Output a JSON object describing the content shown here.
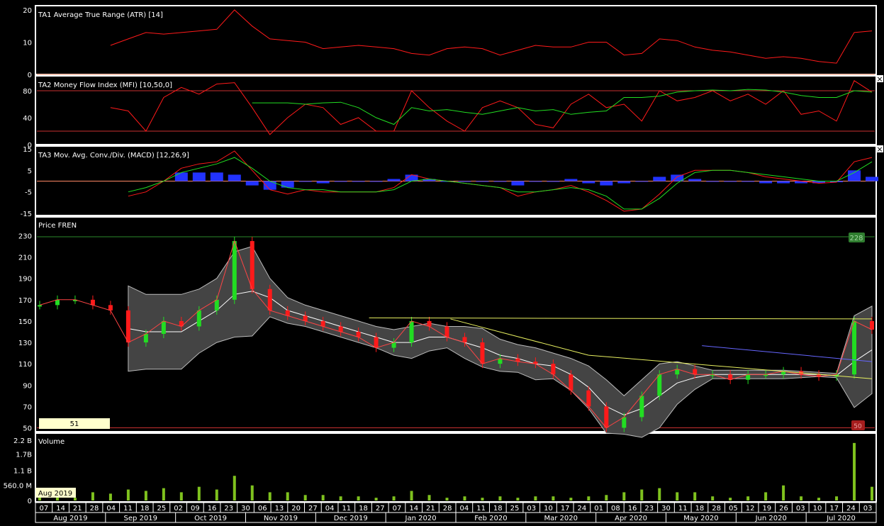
{
  "colors": {
    "background": "#000000",
    "border": "#ffffff",
    "red": "#ff1a1a",
    "green": "#22dd22",
    "blue": "#2233ff",
    "volume": "#7fc21e",
    "band": "#444444",
    "mid": "#ffffff",
    "trend_blue": "#6666ff",
    "trend_yellow": "#e8f060",
    "badge_green": "#2f7d2f",
    "badge_red": "#a51d1d",
    "cursor_label_bg": "#ffffcc"
  },
  "panels": {
    "atr": {
      "title": "TA1 Average True Range (ATR) [14]",
      "ticks": [
        "20",
        "10",
        "0"
      ]
    },
    "mfi": {
      "title": "TA2 Money Flow Index (MFI) [10,50,0]",
      "ticks": [
        "80",
        "40",
        "0"
      ]
    },
    "macd": {
      "title": "TA3 Mov. Avg. Conv./Div. (MACD) [12,26,9]",
      "ticks": [
        "15",
        "5",
        "-5",
        "-15"
      ]
    },
    "price": {
      "title": "Price FREN",
      "ticks": [
        "230",
        "210",
        "190",
        "170",
        "150",
        "130",
        "110",
        "90",
        "70",
        "50"
      ],
      "high_badge": "228",
      "low_badge": "50",
      "cursor_value": "51"
    },
    "volume": {
      "title": "Volume",
      "ticks": [
        "2.2 B",
        "1.7B",
        "1.1 B",
        "560.0 M",
        "0"
      ],
      "cursor_date": "Aug 2019"
    }
  },
  "close_icon": "×",
  "chart_data": [
    {
      "type": "line",
      "title": "TA1 Average True Range (ATR) [14]",
      "ylim": [
        0,
        20
      ],
      "x_index": [
        0,
        5,
        10,
        15,
        20,
        25,
        30,
        35,
        40,
        45,
        50,
        55,
        60,
        65,
        70,
        75,
        80,
        85,
        90,
        95,
        100,
        105,
        110,
        115,
        120,
        125,
        130,
        135,
        140,
        145,
        150,
        155,
        160,
        165,
        170,
        175,
        180,
        185,
        190,
        195,
        200,
        205,
        210,
        215,
        220,
        225,
        230,
        235
      ],
      "series": [
        {
          "values": [
            null,
            null,
            null,
            null,
            9,
            11,
            13,
            12.5,
            13,
            13.5,
            14,
            20,
            15,
            11,
            10.5,
            10,
            8,
            8.5,
            9,
            8.5,
            8,
            6.5,
            6,
            8,
            8.5,
            8,
            6,
            7.5,
            9,
            8.5,
            8.5,
            10,
            10,
            6,
            6.5,
            11,
            10.5,
            8.5,
            7.5,
            7,
            6,
            5,
            5.5,
            5,
            4,
            3.5,
            13,
            13.5
          ]
        }
      ]
    },
    {
      "type": "line",
      "title": "TA2 Money Flow Index (MFI) [10,50,0]",
      "ylim": [
        0,
        100
      ],
      "reference_lines": [
        80,
        20
      ],
      "x_index": [
        0,
        5,
        10,
        15,
        20,
        25,
        30,
        35,
        40,
        45,
        50,
        55,
        60,
        65,
        70,
        75,
        80,
        85,
        90,
        95,
        100,
        105,
        110,
        115,
        120,
        125,
        130,
        135,
        140,
        145,
        150,
        155,
        160,
        165,
        170,
        175,
        180,
        185,
        190,
        195,
        200,
        205,
        210,
        215,
        220,
        225,
        230,
        235
      ],
      "series": [
        {
          "values": [
            null,
            null,
            null,
            null,
            55,
            50,
            20,
            70,
            85,
            75,
            90,
            92,
            55,
            15,
            40,
            60,
            55,
            30,
            40,
            20,
            20,
            80,
            55,
            35,
            20,
            55,
            65,
            55,
            30,
            25,
            60,
            75,
            55,
            60,
            35,
            80,
            65,
            70,
            80,
            65,
            75,
            60,
            80,
            45,
            50,
            35,
            95,
            78
          ]
        },
        {
          "values": [
            null,
            null,
            null,
            null,
            null,
            null,
            null,
            null,
            null,
            null,
            null,
            null,
            62,
            62,
            62,
            60,
            62,
            63,
            55,
            40,
            30,
            55,
            50,
            52,
            48,
            45,
            50,
            55,
            50,
            52,
            45,
            48,
            50,
            70,
            70,
            72,
            78,
            80,
            81,
            80,
            82,
            81,
            78,
            73,
            70,
            70,
            80,
            78
          ]
        }
      ]
    },
    {
      "type": "bar",
      "title": "TA3 Mov. Avg. Conv./Div. (MACD) [12,26,9]",
      "ylim": [
        -15,
        15
      ],
      "x_index": [
        0,
        5,
        10,
        15,
        20,
        25,
        30,
        35,
        40,
        45,
        50,
        55,
        60,
        65,
        70,
        75,
        80,
        85,
        90,
        95,
        100,
        105,
        110,
        115,
        120,
        125,
        130,
        135,
        140,
        145,
        150,
        155,
        160,
        165,
        170,
        175,
        180,
        185,
        190,
        195,
        200,
        205,
        210,
        215,
        220,
        225,
        230,
        235
      ],
      "series": [
        {
          "values": [
            null,
            null,
            null,
            null,
            null,
            -7,
            -5,
            0,
            6,
            8,
            9,
            14,
            5,
            -4,
            -6,
            -4,
            -5,
            -5,
            -5,
            -5,
            -3,
            3,
            1,
            0,
            -1,
            -2,
            -3,
            -7,
            -5,
            -4,
            -2,
            -5,
            -9,
            -14,
            -13,
            -6,
            2,
            5,
            5,
            5,
            4,
            2,
            1,
            0,
            -1,
            -0.5,
            9,
            11
          ]
        },
        {
          "values": [
            null,
            null,
            null,
            null,
            null,
            -5,
            -3,
            0,
            4,
            6,
            8,
            11,
            6,
            0,
            -3,
            -4,
            -4,
            -5,
            -5,
            -5,
            -4,
            0,
            1,
            0,
            -1,
            -2,
            -3,
            -5,
            -5,
            -4,
            -3,
            -4,
            -7,
            -13,
            -13,
            -8,
            -1,
            4,
            5,
            5,
            4,
            3,
            2,
            1,
            0,
            0,
            4,
            9
          ]
        },
        {
          "values": [
            null,
            null,
            null,
            null,
            null,
            null,
            null,
            null,
            4,
            4,
            4,
            3,
            -2,
            -4,
            -3,
            0,
            -1,
            0,
            0,
            0,
            1,
            3,
            1,
            0,
            0,
            0,
            0,
            -2,
            0,
            0,
            1,
            -1,
            -2,
            -1,
            0,
            2,
            3,
            1,
            0,
            0,
            0,
            -1,
            -1,
            -1,
            -1,
            -0.5,
            5,
            2
          ]
        }
      ]
    },
    {
      "type": "line",
      "title": "Price FREN",
      "ylim": [
        45,
        235
      ],
      "x_index": [
        0,
        5,
        10,
        15,
        20,
        25,
        30,
        35,
        40,
        45,
        50,
        55,
        60,
        65,
        70,
        75,
        80,
        85,
        90,
        95,
        100,
        105,
        110,
        115,
        120,
        125,
        130,
        135,
        140,
        145,
        150,
        155,
        160,
        165,
        170,
        175,
        180,
        185,
        190,
        195,
        200,
        205,
        210,
        215,
        220,
        225,
        230,
        235
      ],
      "series": [
        {
          "values": [
            165,
            170,
            170,
            165,
            160,
            130,
            138,
            150,
            145,
            160,
            170,
            225,
            180,
            160,
            155,
            150,
            145,
            140,
            135,
            125,
            130,
            150,
            145,
            135,
            130,
            110,
            115,
            112,
            110,
            100,
            85,
            70,
            50,
            60,
            80,
            100,
            105,
            100,
            100,
            95,
            100,
            100,
            103,
            100,
            98,
            100,
            150,
            142
          ]
        },
        {
          "values": [
            null,
            null,
            null,
            null,
            null,
            143,
            140,
            140,
            140,
            150,
            160,
            175,
            178,
            172,
            160,
            155,
            150,
            145,
            140,
            135,
            130,
            130,
            135,
            135,
            130,
            125,
            118,
            115,
            110,
            108,
            100,
            88,
            70,
            62,
            68,
            80,
            92,
            97,
            100,
            100,
            100,
            100,
            100,
            100,
            100,
            99,
            112,
            123
          ]
        },
        {
          "values": [
            null,
            null,
            null,
            null,
            null,
            183,
            175,
            175,
            175,
            180,
            190,
            215,
            220,
            190,
            172,
            165,
            160,
            155,
            150,
            145,
            142,
            145,
            148,
            145,
            145,
            143,
            133,
            128,
            125,
            120,
            115,
            108,
            95,
            80,
            95,
            110,
            112,
            108,
            104,
            104,
            104,
            104,
            104,
            103,
            102,
            101,
            155,
            164
          ]
        },
        {
          "values": [
            null,
            null,
            null,
            null,
            null,
            103,
            105,
            105,
            105,
            120,
            130,
            135,
            136,
            154,
            148,
            145,
            140,
            135,
            130,
            125,
            118,
            115,
            122,
            125,
            115,
            107,
            103,
            102,
            95,
            96,
            85,
            68,
            45,
            44,
            41,
            50,
            72,
            86,
            96,
            96,
            96,
            96,
            96,
            97,
            98,
            97,
            69,
            82
          ]
        }
      ]
    },
    {
      "type": "bar",
      "title": "Volume",
      "ylim": [
        0,
        2.2
      ],
      "x_index": [
        0,
        5,
        10,
        15,
        20,
        25,
        30,
        35,
        40,
        45,
        50,
        55,
        60,
        65,
        70,
        75,
        80,
        85,
        90,
        95,
        100,
        105,
        110,
        115,
        120,
        125,
        130,
        135,
        140,
        145,
        150,
        155,
        160,
        165,
        170,
        175,
        180,
        185,
        190,
        195,
        200,
        205,
        210,
        215,
        220,
        225,
        230,
        235
      ],
      "series": [
        {
          "values": [
            0.15,
            0.2,
            0.1,
            0.3,
            0.25,
            0.4,
            0.35,
            0.45,
            0.3,
            0.5,
            0.4,
            0.9,
            0.55,
            0.3,
            0.3,
            0.2,
            0.2,
            0.15,
            0.15,
            0.1,
            0.15,
            0.35,
            0.2,
            0.1,
            0.15,
            0.1,
            0.15,
            0.1,
            0.15,
            0.15,
            0.1,
            0.15,
            0.2,
            0.3,
            0.4,
            0.45,
            0.3,
            0.3,
            0.15,
            0.1,
            0.15,
            0.3,
            0.55,
            0.15,
            0.1,
            0.15,
            2.1,
            0.5
          ]
        }
      ]
    }
  ],
  "x_axis": {
    "days": [
      "07",
      "14",
      "21",
      "28",
      "04",
      "11",
      "18",
      "25",
      "02",
      "09",
      "16",
      "23",
      "30",
      "06",
      "13",
      "20",
      "27",
      "04",
      "11",
      "18",
      "27",
      "07",
      "14",
      "21",
      "28",
      "04",
      "11",
      "18",
      "25",
      "03",
      "10",
      "17",
      "24",
      "01",
      "08",
      "16",
      "23",
      "30",
      "11",
      "18",
      "28",
      "05",
      "12",
      "19",
      "26",
      "03",
      "10",
      "17",
      "24",
      "03"
    ],
    "months": [
      "Aug 2019",
      "Sep 2019",
      "Oct 2019",
      "Nov 2019",
      "Dec 2019",
      "Jan 2020",
      "Feb 2020",
      "Mar 2020",
      "Apr 2020",
      "May 2020",
      "Jun 2020",
      "Jul 2020"
    ]
  }
}
